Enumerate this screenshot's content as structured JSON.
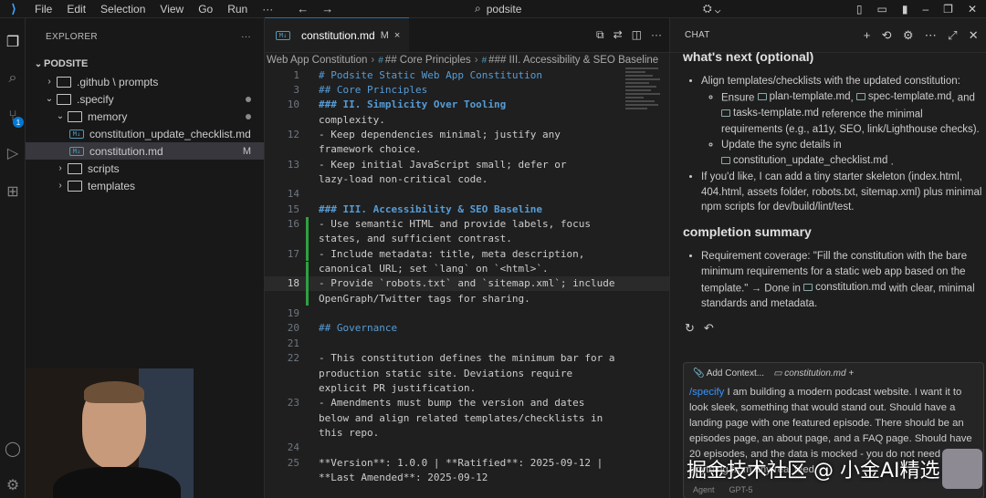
{
  "titlebar": {
    "logo": "⟩",
    "menus": [
      "File",
      "Edit",
      "Selection",
      "View",
      "Go",
      "Run",
      "···"
    ],
    "search": "podsite"
  },
  "activity": {
    "scm_badge": "1"
  },
  "explorer": {
    "header": "EXPLORER",
    "more": "···",
    "root": "PODSITE",
    "items": [
      {
        "label": ".github \\ prompts",
        "depth": 1,
        "type": "folder",
        "chev": "›"
      },
      {
        "label": ".specify",
        "depth": 1,
        "type": "folder",
        "chev": "⌄"
      },
      {
        "label": "memory",
        "depth": 2,
        "type": "folder",
        "chev": "⌄"
      },
      {
        "label": "constitution_update_checklist.md",
        "depth": 3,
        "type": "md"
      },
      {
        "label": "constitution.md",
        "depth": 3,
        "type": "md",
        "flag": "M"
      },
      {
        "label": "scripts",
        "depth": 2,
        "type": "folder",
        "chev": "›"
      },
      {
        "label": "templates",
        "depth": 2,
        "type": "folder",
        "chev": "›"
      }
    ]
  },
  "editor": {
    "tab_label": "constitution.md",
    "tab_flag": "M",
    "tab_close": "×",
    "breadcrumb": [
      "Web App Constitution",
      "## Core Principles",
      "### III. Accessibility & SEO Baseline"
    ],
    "lines": [
      {
        "n": "1",
        "t": "# Podsite Static Web App Constitution",
        "c": "h"
      },
      {
        "n": "3",
        "t": "## Core Principles",
        "c": "h"
      },
      {
        "n": "10",
        "t": "### II. Simplicity Over Tooling",
        "c": "hb"
      },
      {
        "n": "",
        "t": "complexity.",
        "c": ""
      },
      {
        "n": "12",
        "t": "- Keep dependencies minimal; justify any",
        "c": ""
      },
      {
        "n": "",
        "t": "framework choice.",
        "c": ""
      },
      {
        "n": "13",
        "t": "- Keep initial JavaScript small; defer or",
        "c": ""
      },
      {
        "n": "",
        "t": "lazy-load non-critical code.",
        "c": ""
      },
      {
        "n": "14",
        "t": "",
        "c": ""
      },
      {
        "n": "15",
        "t": "### III. Accessibility & SEO Baseline",
        "c": "hb"
      },
      {
        "n": "16",
        "t": "- Use semantic HTML and provide labels, focus",
        "c": ""
      },
      {
        "n": "",
        "t": "states, and sufficient contrast.",
        "c": ""
      },
      {
        "n": "17",
        "t": "- Include metadata: title, meta description,",
        "c": ""
      },
      {
        "n": "",
        "t": "canonical URL; set `lang` on `<html>`.",
        "c": ""
      },
      {
        "n": "18",
        "t": "- Provide `robots.txt` and `sitemap.xml`; include",
        "c": "",
        "cur": true
      },
      {
        "n": "",
        "t": "OpenGraph/Twitter tags for sharing.",
        "c": ""
      },
      {
        "n": "19",
        "t": "",
        "c": ""
      },
      {
        "n": "20",
        "t": "## Governance",
        "c": "h"
      },
      {
        "n": "21",
        "t": "",
        "c": ""
      },
      {
        "n": "22",
        "t": "- This constitution defines the minimum bar for a",
        "c": ""
      },
      {
        "n": "",
        "t": "production static site. Deviations require",
        "c": ""
      },
      {
        "n": "",
        "t": "explicit PR justification.",
        "c": ""
      },
      {
        "n": "23",
        "t": "- Amendments must bump the version and dates",
        "c": ""
      },
      {
        "n": "",
        "t": "below and align related templates/checklists in",
        "c": ""
      },
      {
        "n": "",
        "t": "this repo.",
        "c": ""
      },
      {
        "n": "24",
        "t": "",
        "c": ""
      },
      {
        "n": "25",
        "t": "**Version**: 1.0.0 | **Ratified**: 2025-09-12 |",
        "c": "ver"
      },
      {
        "n": "",
        "t": "**Last Amended**: 2025-09-12",
        "c": "ver"
      }
    ]
  },
  "chat": {
    "header": "CHAT",
    "next_title": "what's next (optional)",
    "next_item1": "Align templates/checklists with the updated constitution:",
    "sub1_pre": "Ensure",
    "sub1_f1": "plan-template.md",
    "sub1_f2": "spec-template.md",
    "sub1_and": ", and",
    "sub1_f3": "tasks-template.md",
    "sub1_post": "reference the minimal requirements (e.g., a11y, SEO, link/Lighthouse checks).",
    "sub2_pre": "Update the sync details in",
    "sub2_f": "constitution_update_checklist.md",
    "next_item2": "If you'd like, I can add a tiny starter skeleton (index.html, 404.html, assets folder, robots.txt, sitemap.xml) plus minimal npm scripts for dev/build/lint/test.",
    "summary_title": "completion summary",
    "summary_pre": "Requirement coverage: \"Fill the constitution with the bare minimum requirements for a static web app based on the template.\" → Done in",
    "summary_file": "constitution.md",
    "summary_post": "with clear, minimal standards and metadata.",
    "add_context": "Add Context...",
    "ctx_file": "constitution.md",
    "prompt_cmd": "/specify",
    "prompt_text": " I am building a modern podcast website. I want it to look sleek, something that would stand out. Should have a landing page with one featured episode. There should be an episodes page, an about page, and a FAQ page. Should have 20 episodes, and the data is mocked - you do not need to pull anything from any real feed.",
    "mode": "Agent",
    "model": "GPT-5"
  },
  "watermark": "掘金技术社区 @ 小金AI精选"
}
